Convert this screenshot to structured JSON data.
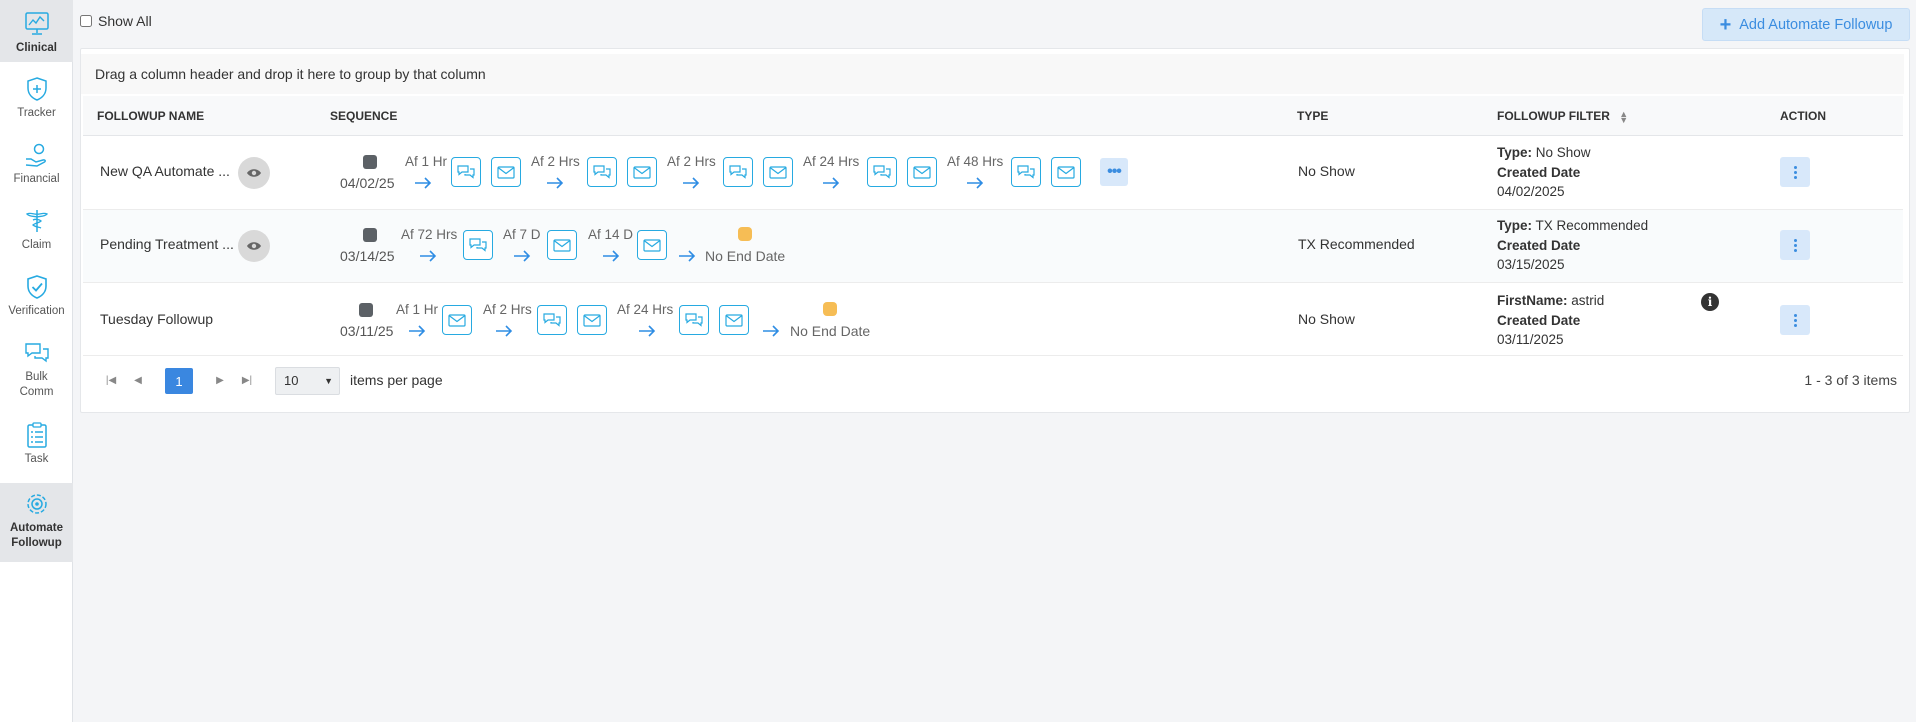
{
  "sidebar": {
    "items": [
      {
        "label": "Clinical",
        "icon": "monitor-chart-icon",
        "active": true
      },
      {
        "label": "Tracker",
        "icon": "shield-plus-icon",
        "active": false
      },
      {
        "label": "Financial",
        "icon": "hand-coin-icon",
        "active": false
      },
      {
        "label": "Claim",
        "icon": "medical-caduceus-icon",
        "active": false
      },
      {
        "label": "Verification",
        "icon": "shield-check-icon",
        "active": false
      },
      {
        "label_line1": "Bulk",
        "label_line2": "Comm",
        "icon": "chat-bubbles-icon",
        "active": false
      },
      {
        "label": "Task",
        "icon": "clipboard-list-icon",
        "active": false
      },
      {
        "label_line1": "Automate",
        "label_line2": "Followup",
        "icon": "gear-cycle-icon",
        "active": true
      }
    ]
  },
  "toolbar": {
    "show_all_label": "Show All",
    "add_button_label": "Add Automate Followup"
  },
  "grid": {
    "group_hint": "Drag a column header and drop it here to group by that column",
    "columns": {
      "name": "FOLLOWUP NAME",
      "sequence": "SEQUENCE",
      "type": "TYPE",
      "filter": "FOLLOWUP FILTER",
      "action": "ACTION"
    },
    "rows": [
      {
        "name": "New QA Automate ...",
        "start_date": "04/02/25",
        "steps": [
          "Af 1 Hr",
          "Af 2 Hrs",
          "Af 2 Hrs",
          "Af 24 Hrs",
          "Af 48 Hrs"
        ],
        "type": "No Show",
        "filter_label1": "Type:",
        "filter_value1": "No Show",
        "filter_label2": "Created Date",
        "filter_value2": "04/02/2025"
      },
      {
        "name": "Pending Treatment ...",
        "start_date": "03/14/25",
        "steps": [
          "Af 72 Hrs",
          "Af 7 D",
          "Af 14 D"
        ],
        "end_label": "No End Date",
        "type": "TX Recommended",
        "filter_label1": "Type:",
        "filter_value1": "TX Recommended",
        "filter_label2": "Created Date",
        "filter_value2": "03/15/2025"
      },
      {
        "name": "Tuesday Followup",
        "start_date": "03/11/25",
        "steps": [
          "Af 1 Hr",
          "Af 2 Hrs",
          "Af 24 Hrs"
        ],
        "end_label": "No End Date",
        "type": "No Show",
        "filter_label1": "FirstName:",
        "filter_value1": "astrid",
        "filter_label2": "Created Date",
        "filter_value2": "03/11/2025"
      }
    ]
  },
  "pager": {
    "current_page": "1",
    "page_size": "10",
    "items_per_page_label": "items per page",
    "info": "1 - 3 of 3 items"
  },
  "colors": {
    "accent": "#3a87e0",
    "icon_teal": "#27aae1",
    "start_marker": "#5c6166",
    "end_marker": "#f6bd55"
  }
}
